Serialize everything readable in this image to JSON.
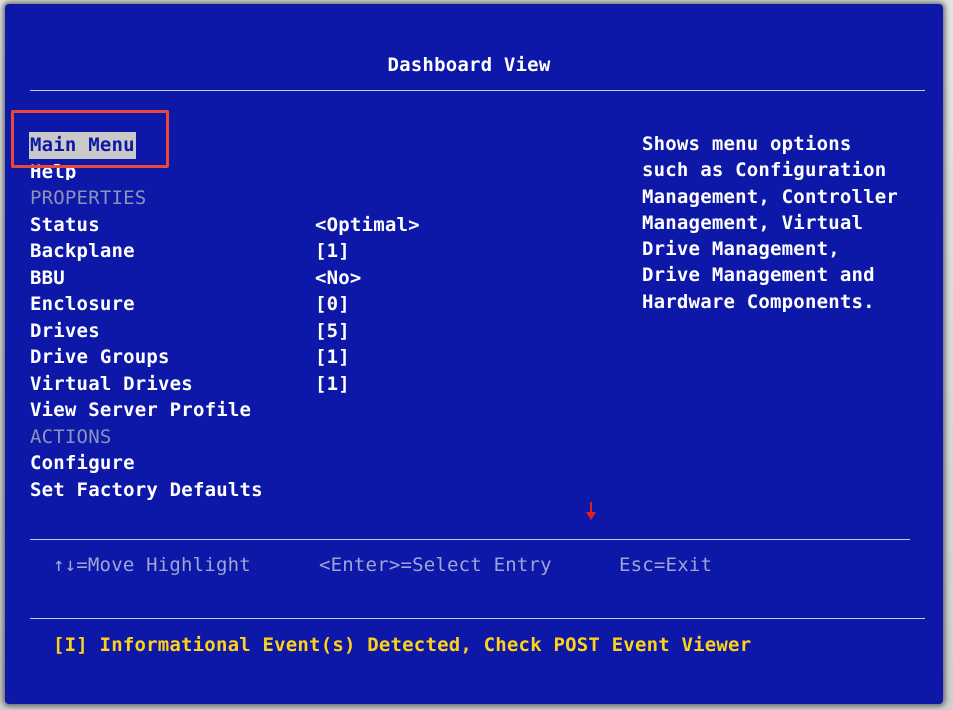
{
  "screen": {
    "title": "Dashboard View"
  },
  "menu": {
    "items": [
      {
        "label": "Main Menu",
        "value": ""
      },
      {
        "label": "Help",
        "value": ""
      },
      {
        "label": "PROPERTIES",
        "value": ""
      },
      {
        "label": "Status",
        "value": "<Optimal>"
      },
      {
        "label": "Backplane",
        "value": "[1]"
      },
      {
        "label": "BBU",
        "value": "<No>"
      },
      {
        "label": "Enclosure",
        "value": "[0]"
      },
      {
        "label": "Drives",
        "value": "[5]"
      },
      {
        "label": "Drive Groups",
        "value": "[1]"
      },
      {
        "label": "Virtual Drives",
        "value": "[1]"
      },
      {
        "label": "View Server Profile",
        "value": ""
      },
      {
        "label": "ACTIONS",
        "value": ""
      },
      {
        "label": "Configure",
        "value": ""
      },
      {
        "label": "Set Factory Defaults",
        "value": ""
      }
    ]
  },
  "help_text": {
    "lines": [
      "Shows menu options",
      "such as Configuration",
      "Management, Controller",
      "Management, Virtual",
      "Drive Management,",
      "Drive Management and",
      "Hardware Components."
    ]
  },
  "keys": {
    "move": "↑↓=Move Highlight",
    "select": "<Enter>=Select Entry",
    "exit": "Esc=Exit"
  },
  "status": {
    "event": "[I] Informational Event(s) Detected, Check POST Event Viewer"
  },
  "colors": {
    "background": "#0d18a8",
    "text": "#ffffff",
    "section": "#8d93b8",
    "event": "#ffd21a",
    "annotation": "#e8483a",
    "scroll_arrow": "#e02020"
  },
  "icons": {
    "scroll": "scroll-down-arrow-icon"
  }
}
